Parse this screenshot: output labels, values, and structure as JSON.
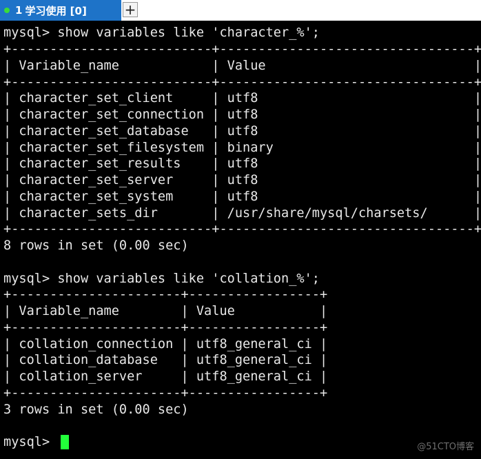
{
  "tab": {
    "status_color": "#3adc3a",
    "number": "1",
    "title": "学习使用 [0]",
    "new_tab_label": "+"
  },
  "terminal": {
    "lines": [
      "mysql> show variables like 'character_%';",
      "+--------------------------+---------------------------------+",
      "| Variable_name            | Value                           |",
      "+--------------------------+---------------------------------+",
      "| character_set_client     | utf8                            |",
      "| character_set_connection | utf8                            |",
      "| character_set_database   | utf8                            |",
      "| character_set_filesystem | binary                          |",
      "| character_set_results    | utf8                            |",
      "| character_set_server     | utf8                            |",
      "| character_set_system     | utf8                            |",
      "| character_sets_dir       | /usr/share/mysql/charsets/      |",
      "+--------------------------+---------------------------------+",
      "8 rows in set (0.00 sec)",
      "",
      "mysql> show variables like 'collation_%';",
      "+----------------------+-----------------+",
      "| Variable_name        | Value           |",
      "+----------------------+-----------------+",
      "| collation_connection | utf8_general_ci |",
      "| collation_database   | utf8_general_ci |",
      "| collation_server     | utf8_general_ci |",
      "+----------------------+-----------------+",
      "3 rows in set (0.00 sec)",
      "",
      "mysql> "
    ],
    "cursor_color": "#22ff3a"
  },
  "watermark": "@51CTO博客"
}
